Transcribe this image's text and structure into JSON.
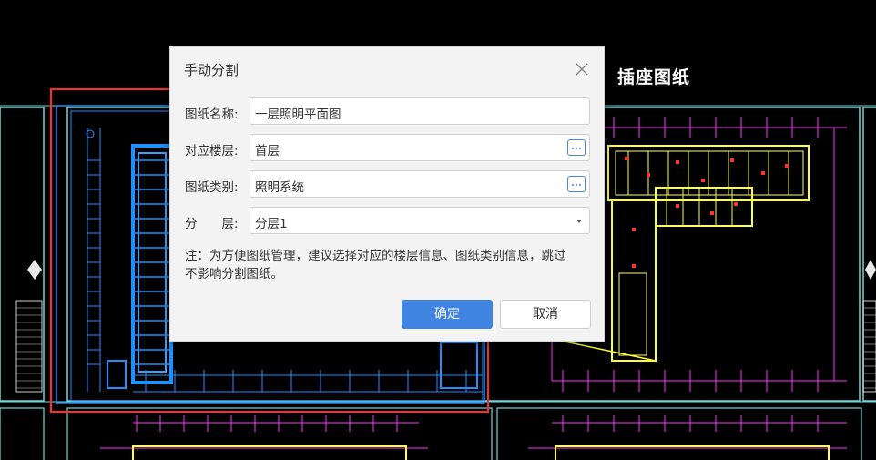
{
  "background": {
    "title": "插座图纸",
    "colors": {
      "frame": "#7fe0e0",
      "selection": "#ff2a2a",
      "plan_blue": "#1e90ff",
      "plan_yellow": "#ffff33",
      "plan_magenta": "#ff33ff"
    }
  },
  "dialog": {
    "title": "手动分割",
    "close_icon": "close-icon",
    "fields": {
      "name": {
        "label": "图纸名称:",
        "value": "一层照明平面图"
      },
      "floor": {
        "label": "对应楼层:",
        "value": "首层",
        "button_icon": "ellipsis-icon"
      },
      "category": {
        "label": "图纸类别:",
        "value": "照明系统",
        "button_icon": "ellipsis-icon"
      },
      "layer": {
        "label": "分　　层:",
        "value": "分层1",
        "caret_icon": "caret-down-icon"
      }
    },
    "note": "注：为方便图纸管理，建议选择对应的楼层信息、图纸类别信息，跳过不影响分割图纸。",
    "buttons": {
      "ok": "确定",
      "cancel": "取消"
    },
    "colors": {
      "primary": "#3e84e0",
      "panel": "#f3f3f3"
    }
  }
}
